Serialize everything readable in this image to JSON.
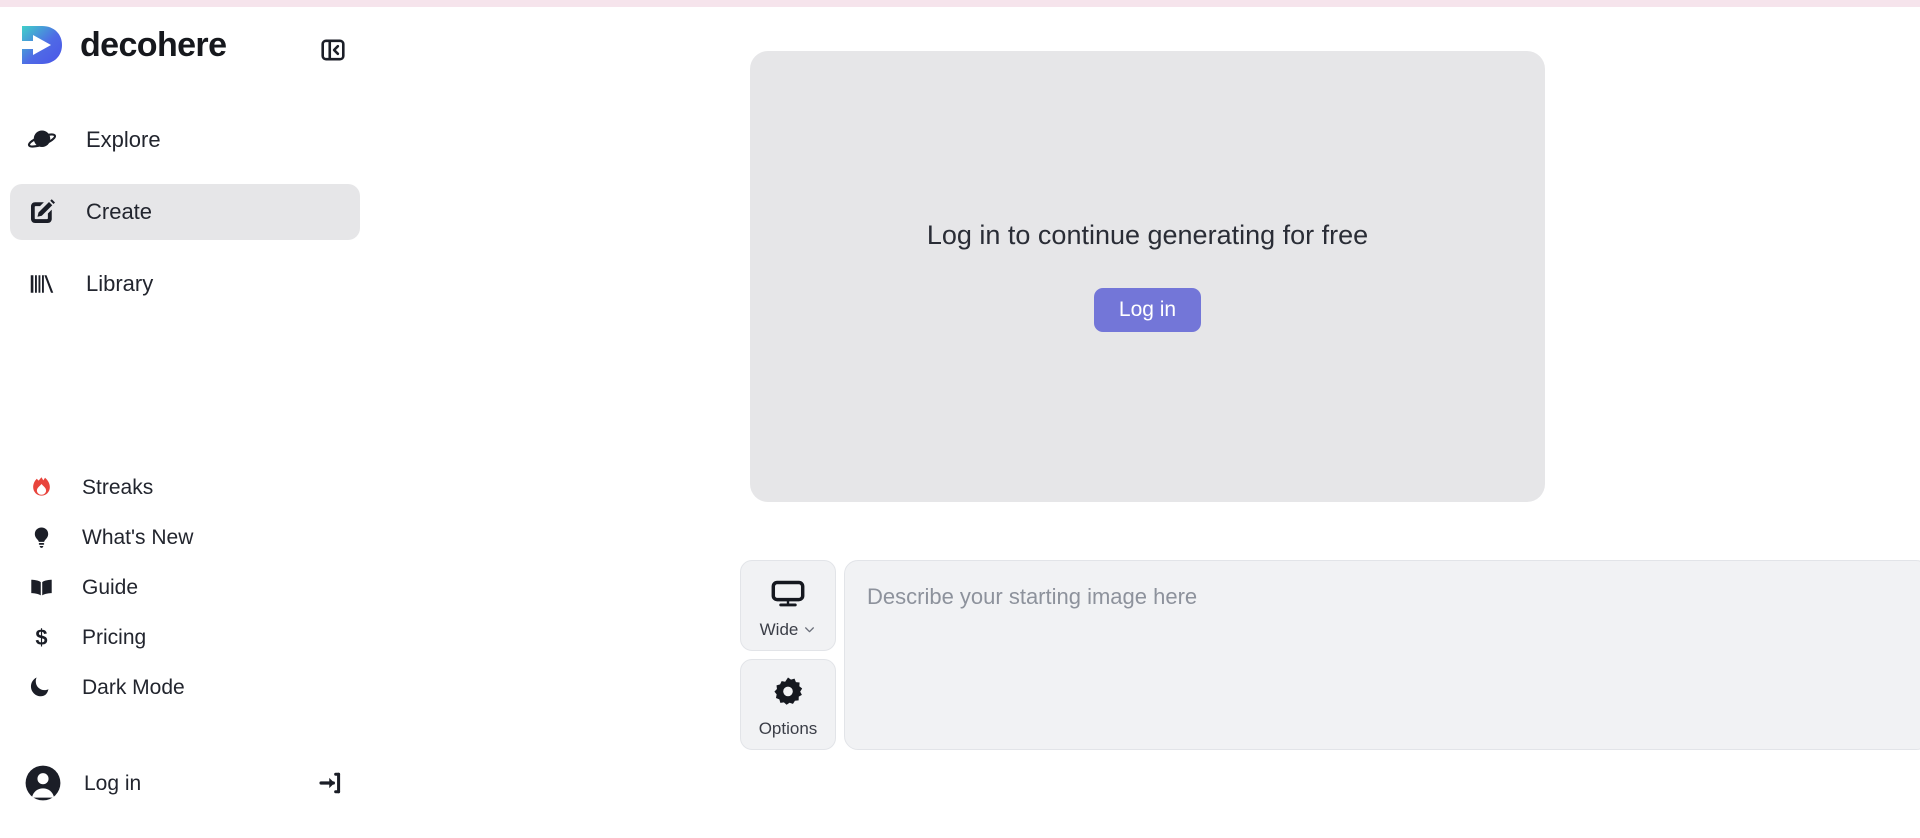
{
  "brand": {
    "name": "decohere",
    "logo_icon": "decohere-play-logo",
    "accent_bar_color": "#f6e4ec",
    "logo_gradient_from": "#3fd0c9",
    "logo_gradient_to": "#4a55e8"
  },
  "sidebar": {
    "collapse_button": {
      "icon": "sidebar-collapse-icon",
      "label": "Collapse sidebar"
    },
    "primary_items": [
      {
        "label": "Explore",
        "icon": "planet-icon",
        "active": false
      },
      {
        "label": "Create",
        "icon": "pencil-square-icon",
        "active": true
      },
      {
        "label": "Library",
        "icon": "books-icon",
        "active": false
      }
    ],
    "secondary_items": [
      {
        "label": "Streaks",
        "icon": "flame-icon",
        "icon_color": "#e8443c"
      },
      {
        "label": "What's New",
        "icon": "lightbulb-icon",
        "icon_color": "#1b1e27"
      },
      {
        "label": "Guide",
        "icon": "open-book-icon",
        "icon_color": "#1b1e27"
      },
      {
        "label": "Pricing",
        "icon": "dollar-sign-icon",
        "icon_color": "#1b1e27"
      },
      {
        "label": "Dark Mode",
        "icon": "moon-icon",
        "icon_color": "#1b1e27"
      }
    ],
    "account": {
      "label": "Log in",
      "avatar_icon": "user-avatar-icon",
      "signin_icon": "sign-in-arrow-icon"
    },
    "active_item_bg": "#e6e6e8"
  },
  "main": {
    "preview": {
      "message": "Log in to continue generating for free",
      "login_button_label": "Log in",
      "login_button_color": "#7376d8",
      "background_color": "#e6e6e8"
    },
    "composer": {
      "aspect_button": {
        "label": "Wide",
        "icon": "monitor-wide-icon",
        "chevron": "chevron-down-icon"
      },
      "options_button": {
        "label": "Options",
        "icon": "gear-icon"
      },
      "prompt": {
        "value": "",
        "placeholder": "Describe your starting image here"
      }
    }
  }
}
